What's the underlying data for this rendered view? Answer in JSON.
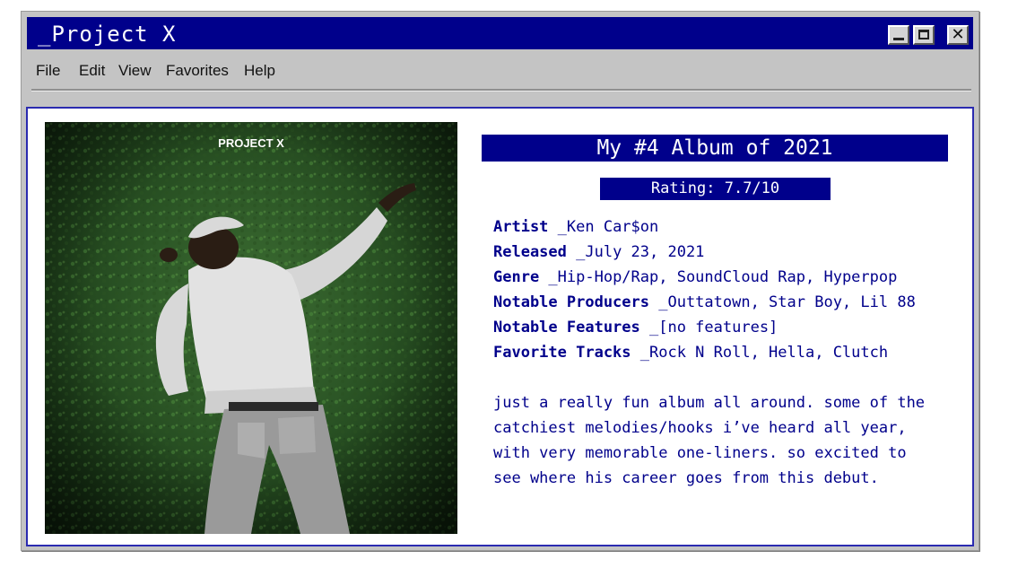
{
  "window": {
    "title": "_Project X"
  },
  "menu": [
    "File",
    "Edit",
    "View",
    "Favorites",
    "Help"
  ],
  "album": {
    "cover_text": "PROJECT X",
    "header": "My #4 Album of 2021",
    "rating": "Rating: 7.7/10",
    "details": [
      {
        "label": "Artist",
        "value": " _Ken Car$on"
      },
      {
        "label": "Released",
        "value": " _July 23, 2021"
      },
      {
        "label": "Genre",
        "value": " _Hip-Hop/Rap, SoundCloud Rap, Hyperpop"
      },
      {
        "label": "Notable Producers",
        "value": " _Outtatown, Star Boy, Lil 88"
      },
      {
        "label": "Notable Features",
        "value": " _[no features]"
      },
      {
        "label": "Favorite Tracks",
        "value": " _Rock N Roll, Hella, Clutch"
      }
    ],
    "review": [
      "just a really fun album all around. some of the",
      "catchiest melodies/hooks i’ve heard all year,",
      "with very memorable one-liners. so excited to",
      "see where his career goes from this debut."
    ]
  },
  "colors": {
    "accent": "#00008b",
    "window_bg": "#c4c4c4",
    "content_border": "#2b2bb0"
  }
}
